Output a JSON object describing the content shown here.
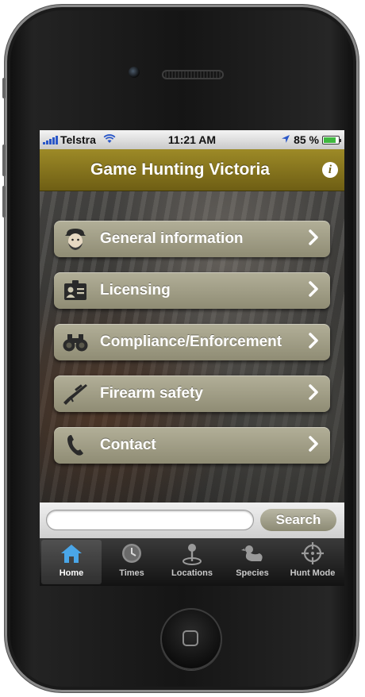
{
  "status_bar": {
    "carrier": "Telstra",
    "time": "11:21 AM",
    "battery_percent": "85 %",
    "battery_level": 0.85,
    "signal_bars": 5
  },
  "nav": {
    "title": "Game Hunting Victoria",
    "info_icon": "info-icon"
  },
  "menu": [
    {
      "label": "General information",
      "icon": "hunter-face-icon"
    },
    {
      "label": "Licensing",
      "icon": "id-card-icon"
    },
    {
      "label": "Compliance/Enforcement",
      "icon": "binoculars-icon"
    },
    {
      "label": "Firearm safety",
      "icon": "rifle-icon"
    },
    {
      "label": "Contact",
      "icon": "phone-icon"
    }
  ],
  "search": {
    "placeholder": "",
    "value": "",
    "button_label": "Search"
  },
  "tabs": [
    {
      "label": "Home",
      "icon": "home-icon",
      "active": true
    },
    {
      "label": "Times",
      "icon": "clock-icon",
      "active": false
    },
    {
      "label": "Locations",
      "icon": "map-pin-icon",
      "active": false
    },
    {
      "label": "Species",
      "icon": "duck-icon",
      "active": false
    },
    {
      "label": "Hunt Mode",
      "icon": "crosshair-icon",
      "active": false
    }
  ],
  "colors": {
    "nav_bar": "#8a7820",
    "menu_button": "#a19e86",
    "status_blue": "#2a57c8"
  }
}
